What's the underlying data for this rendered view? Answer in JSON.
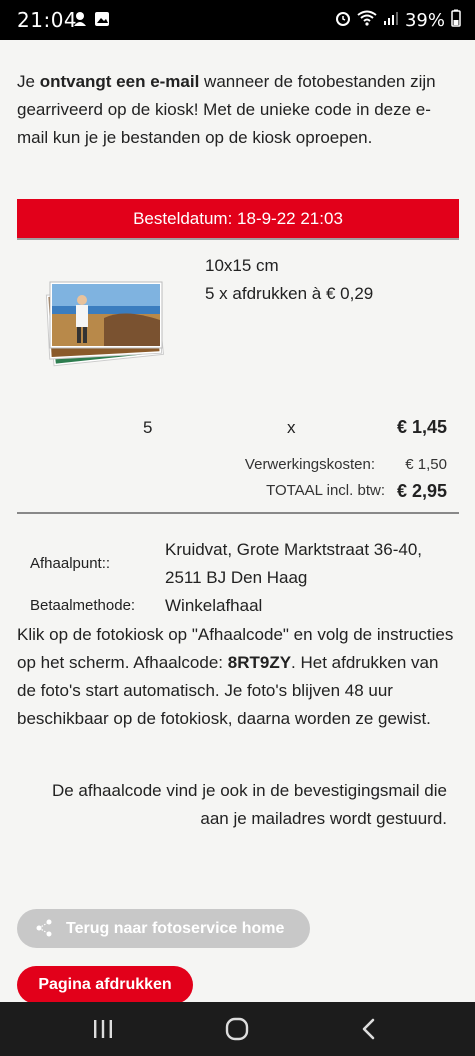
{
  "status_bar": {
    "time": "21:04",
    "battery": "39%"
  },
  "intro": {
    "part1": "Je ",
    "bold": "ontvangt een e-mail",
    "part2": " wanneer de fotobestanden zijn gearriveerd op de kiosk! Met de unieke code in deze e-mail kun je je bestanden op de kiosk oproepen."
  },
  "order": {
    "date_label": "Besteldatum: 18-9-22 21:03",
    "product_size": "10x15 cm",
    "product_desc": "5 x afdrukken à € 0,29",
    "quantity": "5",
    "times": "x",
    "line_total": "€ 1,45",
    "fee_label": "Verwerkingskosten:",
    "fee_value": "€ 1,50",
    "total_label": "TOTAAL incl. btw:",
    "total_value": "€ 2,95"
  },
  "pickup": {
    "label": "Afhaalpunt::",
    "address_line1": "Kruidvat, Grote Marktstraat 36-40,",
    "address_line2": "2511 BJ Den Haag",
    "payment_label": "Betaalmethode:",
    "payment_value": "Winkelafhaal"
  },
  "instructions": {
    "part1": "Klik op de fotokiosk op \"Afhaalcode\" en volg de instructies op het scherm. Afhaalcode: ",
    "code": "8RT9ZY",
    "part2": ". Het afdrukken van de foto's start automatisch. Je foto's blijven 48 uur beschikbaar op de fotokiosk, daarna worden ze gewist."
  },
  "note": "De afhaalcode vind je ook in de bevestigingsmail die aan je mailadres wordt gestuurd.",
  "buttons": {
    "home": "Terug naar fotoservice home",
    "print": "Pagina afdrukken"
  },
  "colors": {
    "accent": "#e2001a",
    "disabled_button": "#c8c8c8"
  }
}
